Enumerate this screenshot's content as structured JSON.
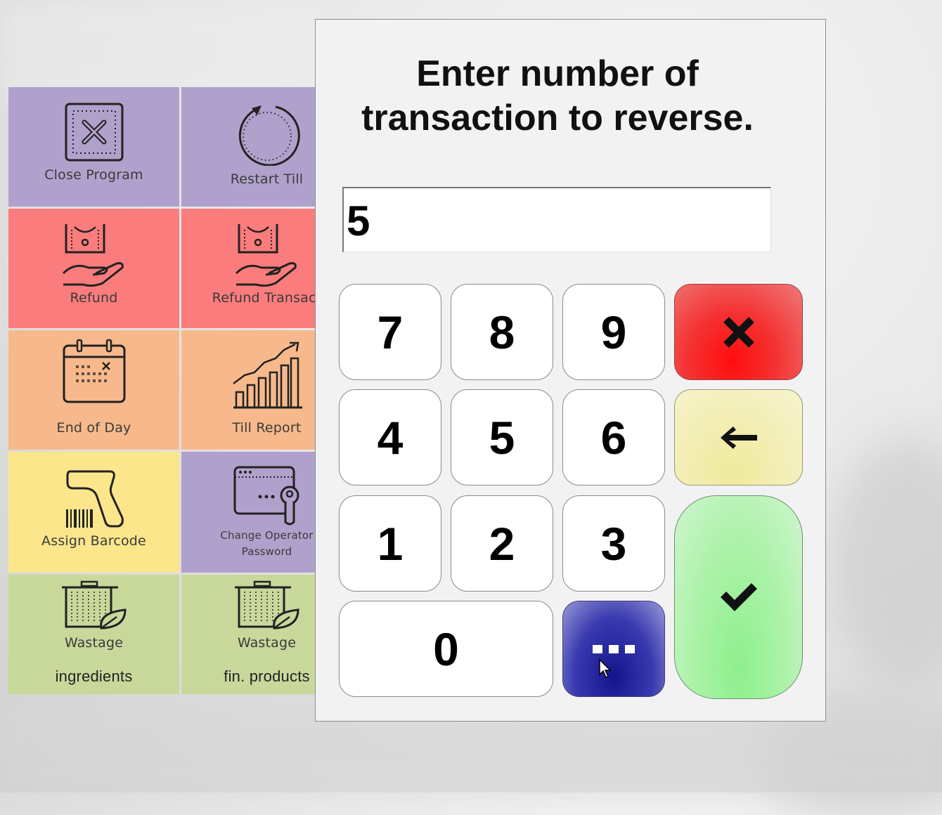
{
  "tiles": [
    {
      "label": "Close Program",
      "icon": "close-program-icon",
      "color": "#b0a1cc"
    },
    {
      "label": "Restart Till",
      "icon": "restart-icon",
      "color": "#b0a1cc"
    },
    {
      "label": "Refund",
      "icon": "refund-icon",
      "color": "#fb7c7c"
    },
    {
      "label": "Refund Transact",
      "icon": "refund-transaction-icon",
      "color": "#fb7c7c"
    },
    {
      "label": "End of Day",
      "icon": "calendar-icon",
      "color": "#f7b98b"
    },
    {
      "label": "Till Report",
      "icon": "chart-icon",
      "color": "#f7b98b"
    },
    {
      "label": "Assign Barcode",
      "icon": "barcode-scanner-icon",
      "color": "#fbe68c"
    },
    {
      "label": "Change Operator",
      "label_line2": "Password",
      "icon": "password-icon",
      "color": "#b0a1cc"
    },
    {
      "label": "Wastage",
      "label_sub": "ingredients",
      "icon": "wastage-bin-icon",
      "color": "#c8d89b"
    },
    {
      "label": "Wastage",
      "label_sub": "fin. products",
      "icon": "wastage-bin-icon",
      "color": "#c8d89b"
    }
  ],
  "dialog": {
    "prompt_line1": "Enter number of",
    "prompt_line2": "transaction to reverse.",
    "entry_value": "5"
  },
  "keypad": {
    "k7": "7",
    "k8": "8",
    "k9": "9",
    "k4": "4",
    "k5": "5",
    "k6": "6",
    "k1": "1",
    "k2": "2",
    "k3": "3",
    "k0": "0",
    "cancel_icon": "x-icon",
    "backspace_icon": "arrow-left-icon",
    "confirm_icon": "checkmark-icon",
    "more_icon": "ellipsis-icon"
  }
}
